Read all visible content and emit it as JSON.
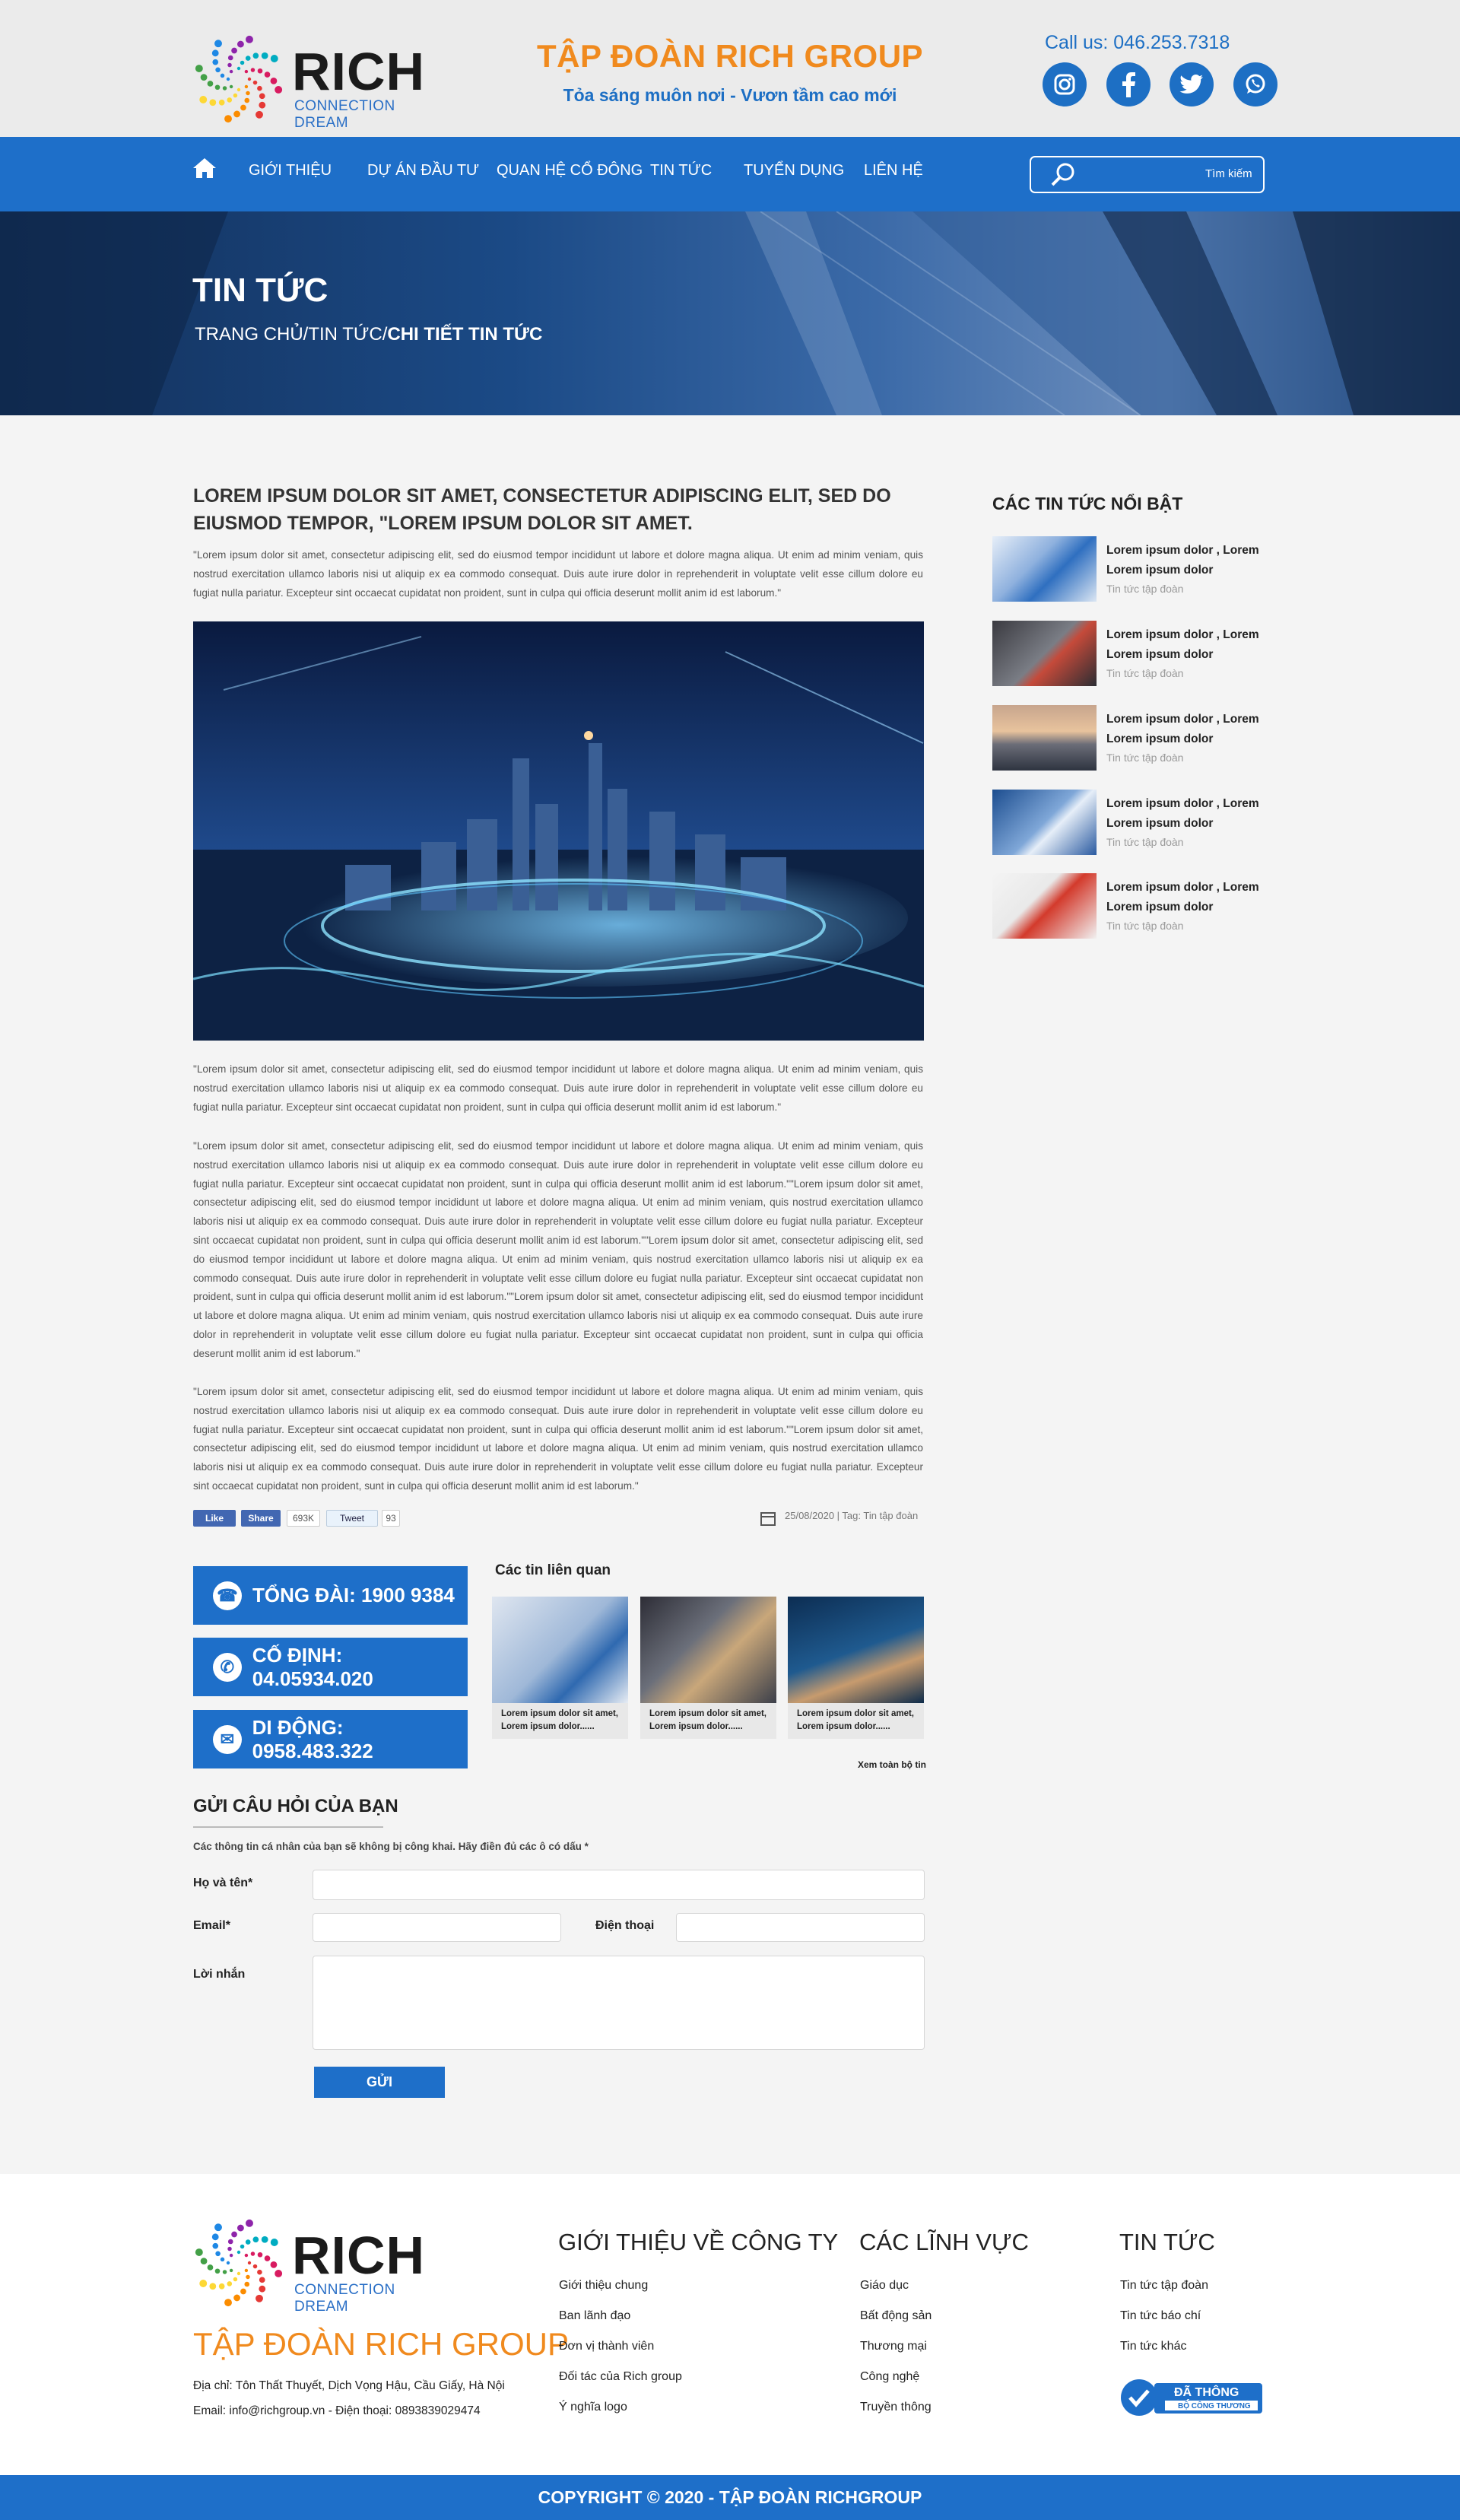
{
  "header": {
    "logo_word": "RICH",
    "logo_sub": "CONNECTION DREAM",
    "brand_title": "TẬP ĐOÀN RICH GROUP",
    "brand_slogan": "Tỏa sáng muôn nơi - Vươn tầm cao mới",
    "call_us": "Call us: 046.253.7318",
    "social": [
      "instagram-icon",
      "facebook-icon",
      "twitter-icon",
      "whatsapp-icon"
    ]
  },
  "nav": {
    "items": [
      "GIỚI THIỆU",
      "DỰ ÁN ĐẦU TƯ",
      "QUAN HỆ CỔ ĐÔNG",
      "TIN TỨC",
      "TUYỂN DỤNG",
      "LIÊN HỆ"
    ],
    "search_placeholder": "Tìm kiếm"
  },
  "hero": {
    "title": "TIN TỨC",
    "crumb_plain": "TRANG CHỦ/TIN TỨC/",
    "crumb_bold": "CHI TIẾT TIN TỨC"
  },
  "article": {
    "title": "LOREM IPSUM DOLOR SIT AMET, CONSECTETUR ADIPISCING ELIT, SED DO EIUSMOD TEMPOR, \"LOREM IPSUM DOLOR SIT AMET.",
    "intro": "\"Lorem ipsum dolor sit amet, consectetur adipiscing elit, sed do eiusmod tempor incididunt ut labore et dolore magna aliqua. Ut enim ad minim veniam, quis nostrud exercitation ullamco laboris nisi ut aliquip ex ea commodo consequat. Duis aute irure dolor in reprehenderit in voluptate velit esse cillum dolore eu fugiat nulla pariatur. Excepteur sint occaecat cupidatat non proident, sunt in culpa qui officia deserunt mollit anim id est laborum.\"",
    "p1": "\"Lorem ipsum dolor sit amet, consectetur adipiscing elit, sed do eiusmod tempor incididunt ut labore et dolore magna aliqua. Ut enim ad minim veniam, quis nostrud exercitation ullamco laboris nisi ut aliquip ex ea commodo consequat. Duis aute irure dolor in reprehenderit in voluptate velit esse cillum dolore eu fugiat nulla pariatur. Excepteur sint occaecat cupidatat non proident, sunt in culpa qui officia deserunt mollit anim id est laborum.\"",
    "p2": "\"Lorem ipsum dolor sit amet, consectetur adipiscing elit, sed do eiusmod tempor incididunt ut labore et dolore magna aliqua. Ut enim ad minim veniam, quis nostrud exercitation ullamco laboris nisi ut aliquip ex ea commodo consequat. Duis aute irure dolor in reprehenderit in voluptate velit esse cillum dolore eu fugiat nulla pariatur. Excepteur sint occaecat cupidatat non proident, sunt in culpa qui officia deserunt mollit anim id est laborum.\"\"Lorem ipsum dolor sit amet, consectetur adipiscing elit, sed do eiusmod tempor incididunt ut labore et dolore magna aliqua. Ut enim ad minim veniam, quis nostrud exercitation ullamco laboris nisi ut aliquip ex ea commodo consequat. Duis aute irure dolor in reprehenderit in voluptate velit esse cillum dolore eu fugiat nulla pariatur. Excepteur sint occaecat cupidatat non proident, sunt in culpa qui officia deserunt mollit anim id est laborum.\"\"Lorem ipsum dolor sit amet, consectetur adipiscing elit, sed do eiusmod tempor incididunt ut labore et dolore magna aliqua. Ut enim ad minim veniam, quis nostrud exercitation ullamco laboris nisi ut aliquip ex ea commodo consequat. Duis aute irure dolor in reprehenderit in voluptate velit esse cillum dolore eu fugiat nulla pariatur. Excepteur sint occaecat cupidatat non proident, sunt in culpa qui officia deserunt mollit anim id est laborum.\"\"Lorem ipsum dolor sit amet, consectetur adipiscing elit, sed do eiusmod tempor incididunt ut labore et dolore magna aliqua. Ut enim ad minim veniam, quis nostrud exercitation ullamco laboris nisi ut aliquip ex ea commodo consequat. Duis aute irure dolor in reprehenderit in voluptate velit esse cillum dolore eu fugiat nulla pariatur. Excepteur sint occaecat cupidatat non proident, sunt in culpa qui officia deserunt mollit anim id est laborum.\"",
    "p3": "\"Lorem ipsum dolor sit amet, consectetur adipiscing elit, sed do eiusmod tempor incididunt ut labore et dolore magna aliqua. Ut enim ad minim veniam, quis nostrud exercitation ullamco laboris nisi ut aliquip ex ea commodo consequat. Duis aute irure dolor in reprehenderit in voluptate velit esse cillum dolore eu fugiat nulla pariatur. Excepteur sint occaecat cupidatat non proident, sunt in culpa qui officia deserunt mollit anim id est laborum.\"\"Lorem ipsum dolor sit amet, consectetur adipiscing elit, sed do eiusmod tempor incididunt ut labore et dolore magna aliqua. Ut enim ad minim veniam, quis nostrud exercitation ullamco laboris nisi ut aliquip ex ea commodo consequat. Duis aute irure dolor in reprehenderit in voluptate velit esse cillum dolore eu fugiat nulla pariatur. Excepteur sint occaecat cupidatat non proident, sunt in culpa qui officia deserunt mollit anim id est laborum.\"",
    "share": {
      "like": "Like",
      "share": "Share",
      "like_count": "693K",
      "tweet": "Tweet",
      "tweet_count": "93"
    },
    "meta": "25/08/2020  |  Tag: Tin tập đoàn"
  },
  "hotlines": [
    {
      "label": "TỔNG ĐÀI: 1900 9384",
      "icon": "headset-icon"
    },
    {
      "label": "CỐ ĐỊNH: 04.05934.020",
      "icon": "phone-icon"
    },
    {
      "label": "DI ĐỘNG: 0958.483.322",
      "icon": "mobile-icon"
    }
  ],
  "related": {
    "title": "Các tin liên quan",
    "items": [
      {
        "text": "Lorem ipsum dolor sit amet, Lorem ipsum dolor......"
      },
      {
        "text": "Lorem ipsum dolor sit amet, Lorem ipsum dolor......"
      },
      {
        "text": "Lorem ipsum dolor sit amet, Lorem ipsum dolor......"
      }
    ],
    "more": "Xem toàn bộ tin"
  },
  "form": {
    "title": "GỬI CÂU HỎI CỦA BẠN",
    "note": "Các thông tin cá nhân của bạn sẽ không bị công khai. Hãy điền đủ các ô có dấu *",
    "name_label": "Họ và tên*",
    "email_label": "Email*",
    "phone_label": "Điện thoại",
    "message_label": "Lời nhắn",
    "submit": "GỬI"
  },
  "sidebar": {
    "title": "CÁC TIN TỨC NỔI BẬT",
    "items": [
      {
        "title": "Lorem ipsum dolor , Lorem Lorem ipsum dolor",
        "cat": "Tin tức tập đoàn"
      },
      {
        "title": "Lorem ipsum dolor , Lorem Lorem ipsum dolor",
        "cat": "Tin tức tập đoàn"
      },
      {
        "title": "Lorem ipsum dolor , Lorem Lorem ipsum dolor",
        "cat": "Tin tức tập đoàn"
      },
      {
        "title": "Lorem ipsum dolor , Lorem Lorem ipsum dolor",
        "cat": "Tin tức tập đoàn"
      },
      {
        "title": "Lorem ipsum dolor , Lorem Lorem ipsum dolor",
        "cat": "Tin tức tập đoàn"
      }
    ]
  },
  "footer": {
    "brand": "TẬP ĐOÀN RICH GROUP",
    "address": "Địa chỉ: Tôn Thất Thuyết, Dịch Vọng Hậu, Cầu Giấy, Hà Nội",
    "contact": "Email: info@richgroup.vn - Điện thoại: 0893839029474",
    "col1": {
      "title": "GIỚI THIỆU VỀ CÔNG TY",
      "links": [
        "Giới thiệu chung",
        "Ban lãnh đạo",
        "Đơn vị thành viên",
        "Đối tác của Rich group",
        "Ý nghĩa logo"
      ]
    },
    "col2": {
      "title": "CÁC LĨNH VỰC",
      "links": [
        "Giáo dục",
        "Bất động sản",
        "Thương mại",
        "Công nghệ",
        "Truyền thông"
      ]
    },
    "col3": {
      "title": "TIN TỨC",
      "links": [
        "Tin tức tập đoàn",
        "Tin tức báo chí",
        "Tin tức khác"
      ]
    },
    "badge_main": "ĐÃ THÔNG BÁO",
    "badge_sub": "BỘ CÔNG THƯƠNG",
    "copyright": "COPYRIGHT © 2020 - TẬP ĐOÀN RICHGROUP"
  },
  "colors": {
    "primary": "#1e6fc9",
    "accent": "#f08a1e"
  }
}
